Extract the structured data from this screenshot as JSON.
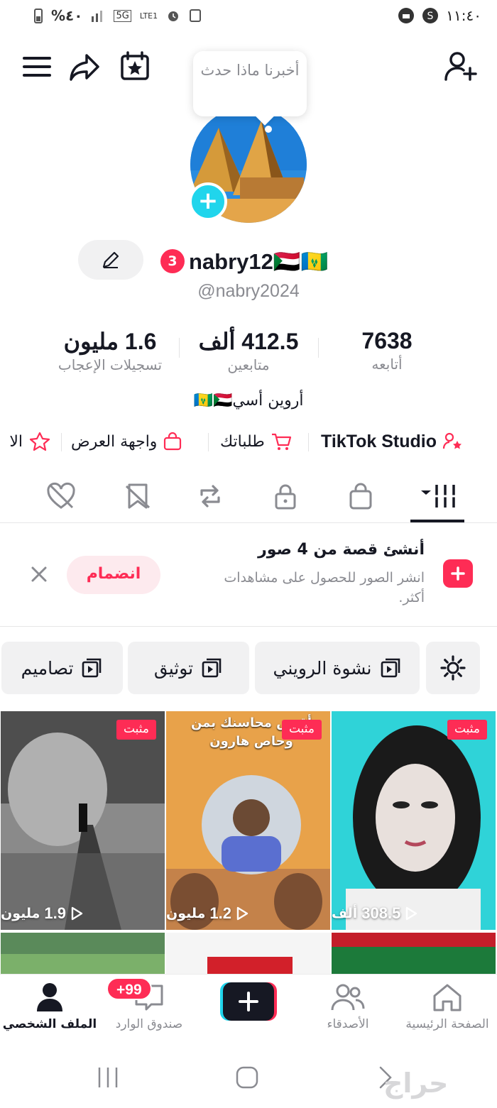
{
  "status_bar": {
    "left_battery": "%٤٠",
    "network": "5G",
    "network_sub": "LTE1",
    "time": "١١:٤٠"
  },
  "header": {
    "tooltip": "أخبرنا ماذا حدث",
    "icons": [
      "menu-icon",
      "share-icon",
      "calendar-star-icon",
      "add-user-icon"
    ]
  },
  "profile": {
    "notification_count": "3",
    "username": "nabry12🇸🇩🇻🇨",
    "handle": "@nabry2024",
    "bio": "أروين أسي🇻🇨🇸🇩",
    "stats": [
      {
        "value": "7638",
        "label": "أتابعه"
      },
      {
        "value": "412.5 ألف",
        "label": "متابعين"
      },
      {
        "value": "1.6 مليون",
        "label": "تسجيلات الإعجاب"
      }
    ]
  },
  "links": {
    "studio": "TikTok Studio",
    "orders": "طلباتك",
    "showcase": "واجهة العرض",
    "more": "الا"
  },
  "story_banner": {
    "title": "أنشئ قصة من 4 صور",
    "subtitle": "انشر الصور للحصول على مشاهدات أكثر.",
    "join": "انضمام"
  },
  "playlists": [
    "نشوة الرويني",
    "توثيق",
    "تصاميم"
  ],
  "videos": [
    {
      "pinned": "مثبت",
      "views": "308.5",
      "unit": "ألف"
    },
    {
      "pinned": "مثبت",
      "views": "1.2",
      "unit": "مليون",
      "caption": "أقتص محاسنك بمن وحاص هارون"
    },
    {
      "pinned": "مثبت",
      "views": "1.9",
      "unit": "مليون"
    }
  ],
  "bottom_nav": {
    "home": "الصفحة الرئيسية",
    "friends": "الأصدقاء",
    "inbox": "صندوق الوارد",
    "inbox_badge": "+99",
    "profile": "الملف الشخصي"
  },
  "watermark": "حراج",
  "colors": {
    "accent": "#fe2c55",
    "cyan": "#20d5ec",
    "text": "#161823",
    "muted": "#8a8b91"
  }
}
